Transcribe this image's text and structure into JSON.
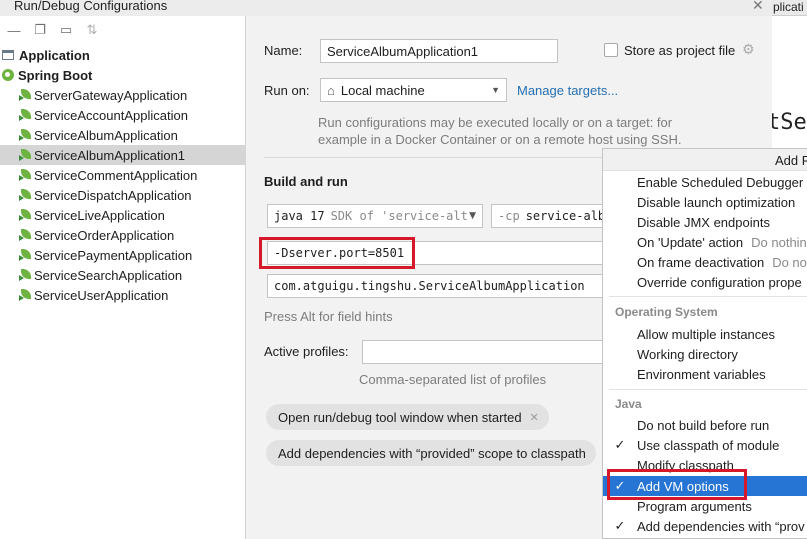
{
  "window": {
    "title": "Run/Debug Configurations",
    "background_tab": "plicati",
    "background_code": "tSe"
  },
  "tree": {
    "groups": [
      {
        "label": "Application"
      },
      {
        "label": "Spring Boot"
      }
    ],
    "items": [
      {
        "label": "ServerGatewayApplication"
      },
      {
        "label": "ServiceAccountApplication"
      },
      {
        "label": "ServiceAlbumApplication"
      },
      {
        "label": "ServiceAlbumApplication1"
      },
      {
        "label": "ServiceCommentApplication"
      },
      {
        "label": "ServiceDispatchApplication"
      },
      {
        "label": "ServiceLiveApplication"
      },
      {
        "label": "ServiceOrderApplication"
      },
      {
        "label": "ServicePaymentApplication"
      },
      {
        "label": "ServiceSearchApplication"
      },
      {
        "label": "ServiceUserApplication"
      }
    ],
    "selected": "ServiceAlbumApplication1"
  },
  "form": {
    "name_label": "Name:",
    "name_value": "ServiceAlbumApplication1",
    "store_label": "Store as project file",
    "run_on_label": "Run on:",
    "run_on_value": "Local machine",
    "manage_targets": "Manage targets...",
    "run_on_hint_1": "Run configurations may be executed locally or on a target: for",
    "run_on_hint_2": "example in a Docker Container or on a remote host using SSH.",
    "build_run_title": "Build and run",
    "jdk_version": "java 17",
    "jdk_suffix": "SDK of 'service-alt",
    "cp_flag": "-cp",
    "cp_value": "service-alb",
    "vm_options": "-Dserver.port=8501",
    "main_class": "com.atguigu.tingshu.ServiceAlbumApplication",
    "field_hint": "Press Alt for field hints",
    "profiles_label": "Active profiles:",
    "profiles_hint": "Comma-separated list of profiles",
    "chips": [
      "Open run/debug tool window when started",
      "Add dependencies with “provided” scope to classpath"
    ]
  },
  "menu": {
    "header": "Add R",
    "items_top": [
      {
        "label": "Enable Scheduled Debugger",
        "sub": ""
      },
      {
        "label": "Disable launch optimization",
        "sub": ""
      },
      {
        "label": "Disable JMX endpoints",
        "sub": ""
      },
      {
        "label": "On 'Update' action",
        "sub": "Do nothin"
      },
      {
        "label": "On frame deactivation",
        "sub": "Do not"
      },
      {
        "label": "Override configuration prope",
        "sub": ""
      }
    ],
    "os_group": "Operating System",
    "items_os": [
      {
        "label": "Allow multiple instances"
      },
      {
        "label": "Working directory"
      },
      {
        "label": "Environment variables"
      }
    ],
    "java_group": "Java",
    "items_java": [
      {
        "label": "Do not build before run",
        "checked": ""
      },
      {
        "label": "Use classpath of module",
        "checked": "✓"
      },
      {
        "label": "Modify classpath",
        "checked": ""
      },
      {
        "label": "Add VM options",
        "checked": "✓"
      },
      {
        "label": "Program arguments",
        "checked": ""
      },
      {
        "label": "Add dependencies with “prov",
        "checked": "✓"
      }
    ],
    "highlighted": "Add VM options"
  },
  "colors": {
    "accent": "#2675d4",
    "highlight_box": "#d5192b",
    "selection": "#d5d5d5",
    "link": "#2470b3"
  }
}
